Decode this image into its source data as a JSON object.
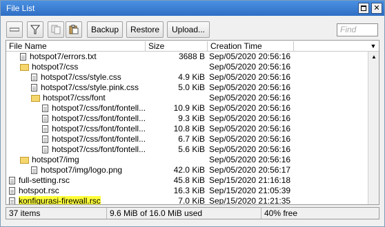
{
  "window": {
    "title": "File List"
  },
  "toolbar": {
    "backup_label": "Backup",
    "restore_label": "Restore",
    "upload_label": "Upload...",
    "find_placeholder": "Find"
  },
  "table": {
    "columns": {
      "name": "File Name",
      "size": "Size",
      "time": "Creation Time"
    },
    "rows": [
      {
        "name": "hotspot7/errors.txt",
        "size": "3688 B",
        "time": "Sep/05/2020 20:56:16",
        "type": "file",
        "indent": 1
      },
      {
        "name": "hotspot7/css",
        "size": "",
        "time": "Sep/05/2020 20:56:16",
        "type": "folder",
        "indent": 1
      },
      {
        "name": "hotspot7/css/style.css",
        "size": "4.9 KiB",
        "time": "Sep/05/2020 20:56:16",
        "type": "file",
        "indent": 2
      },
      {
        "name": "hotspot7/css/style.pink.css",
        "size": "5.0 KiB",
        "time": "Sep/05/2020 20:56:16",
        "type": "file",
        "indent": 2
      },
      {
        "name": "hotspot7/css/font",
        "size": "",
        "time": "Sep/05/2020 20:56:16",
        "type": "folder",
        "indent": 2
      },
      {
        "name": "hotspot7/css/font/fontell...",
        "size": "10.9 KiB",
        "time": "Sep/05/2020 20:56:16",
        "type": "file",
        "indent": 3
      },
      {
        "name": "hotspot7/css/font/fontell...",
        "size": "9.3 KiB",
        "time": "Sep/05/2020 20:56:16",
        "type": "file",
        "indent": 3
      },
      {
        "name": "hotspot7/css/font/fontell...",
        "size": "10.8 KiB",
        "time": "Sep/05/2020 20:56:16",
        "type": "file",
        "indent": 3
      },
      {
        "name": "hotspot7/css/font/fontell...",
        "size": "6.7 KiB",
        "time": "Sep/05/2020 20:56:16",
        "type": "file",
        "indent": 3
      },
      {
        "name": "hotspot7/css/font/fontell...",
        "size": "5.6 KiB",
        "time": "Sep/05/2020 20:56:16",
        "type": "file",
        "indent": 3
      },
      {
        "name": "hotspot7/img",
        "size": "",
        "time": "Sep/05/2020 20:56:16",
        "type": "folder",
        "indent": 1
      },
      {
        "name": "hotspot7/img/logo.png",
        "size": "42.0 KiB",
        "time": "Sep/05/2020 20:56:17",
        "type": "file",
        "indent": 2
      },
      {
        "name": "full-setting.rsc",
        "size": "45.8 KiB",
        "time": "Sep/15/2020 21:16:18",
        "type": "file",
        "indent": 0
      },
      {
        "name": "hotspot.rsc",
        "size": "16.3 KiB",
        "time": "Sep/15/2020 21:05:39",
        "type": "file",
        "indent": 0
      },
      {
        "name": "konfigurasi-firewall.rsc",
        "size": "7.0 KiB",
        "time": "Sep/15/2020 21:21:35",
        "type": "file",
        "indent": 0,
        "highlighted": true
      }
    ]
  },
  "status": {
    "items_count": "37 items",
    "usage": "9.6 MiB of 16.0 MiB used",
    "free": "40% free"
  },
  "colors": {
    "titlebar": "#3a7fd5",
    "highlight": "#ffff3a",
    "folder": "#f5d76e"
  }
}
